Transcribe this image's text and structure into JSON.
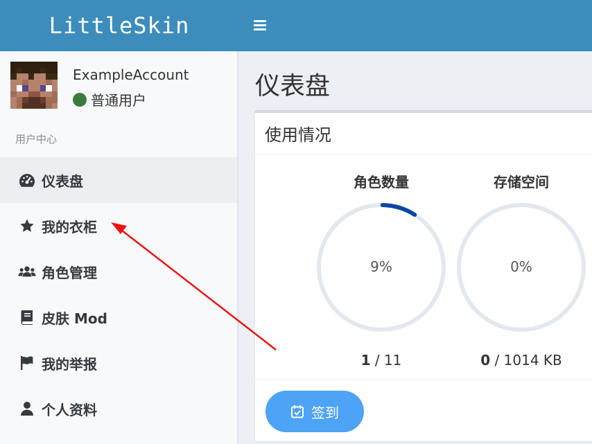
{
  "header": {
    "brand": "LittleSkin"
  },
  "user": {
    "name": "ExampleAccount",
    "role": "普通用户"
  },
  "sidebar": {
    "section_label": "用户中心",
    "items": [
      {
        "label": "仪表盘",
        "icon": "dashboard-icon"
      },
      {
        "label": "我的衣柜",
        "icon": "star-icon"
      },
      {
        "label": "角色管理",
        "icon": "users-icon"
      },
      {
        "label": "皮肤 Mod",
        "icon": "book-icon"
      },
      {
        "label": "我的举报",
        "icon": "flag-icon"
      },
      {
        "label": "个人资料",
        "icon": "user-icon"
      }
    ]
  },
  "main": {
    "title": "仪表盘",
    "card_title": "使用情况",
    "stats": [
      {
        "label": "角色数量",
        "percent": "9%",
        "used": "1",
        "total": " / 11",
        "fraction": 0.09
      },
      {
        "label": "存储空间",
        "percent": "0%",
        "used": "0",
        "total": " / 1014 KB",
        "fraction": 0.0
      }
    ],
    "checkin_label": "签到"
  },
  "colors": {
    "header": "#3c8dbc",
    "gauge_track": "#e3e8ef",
    "gauge_fill": "#0d47a1",
    "button": "#4da3f5"
  }
}
